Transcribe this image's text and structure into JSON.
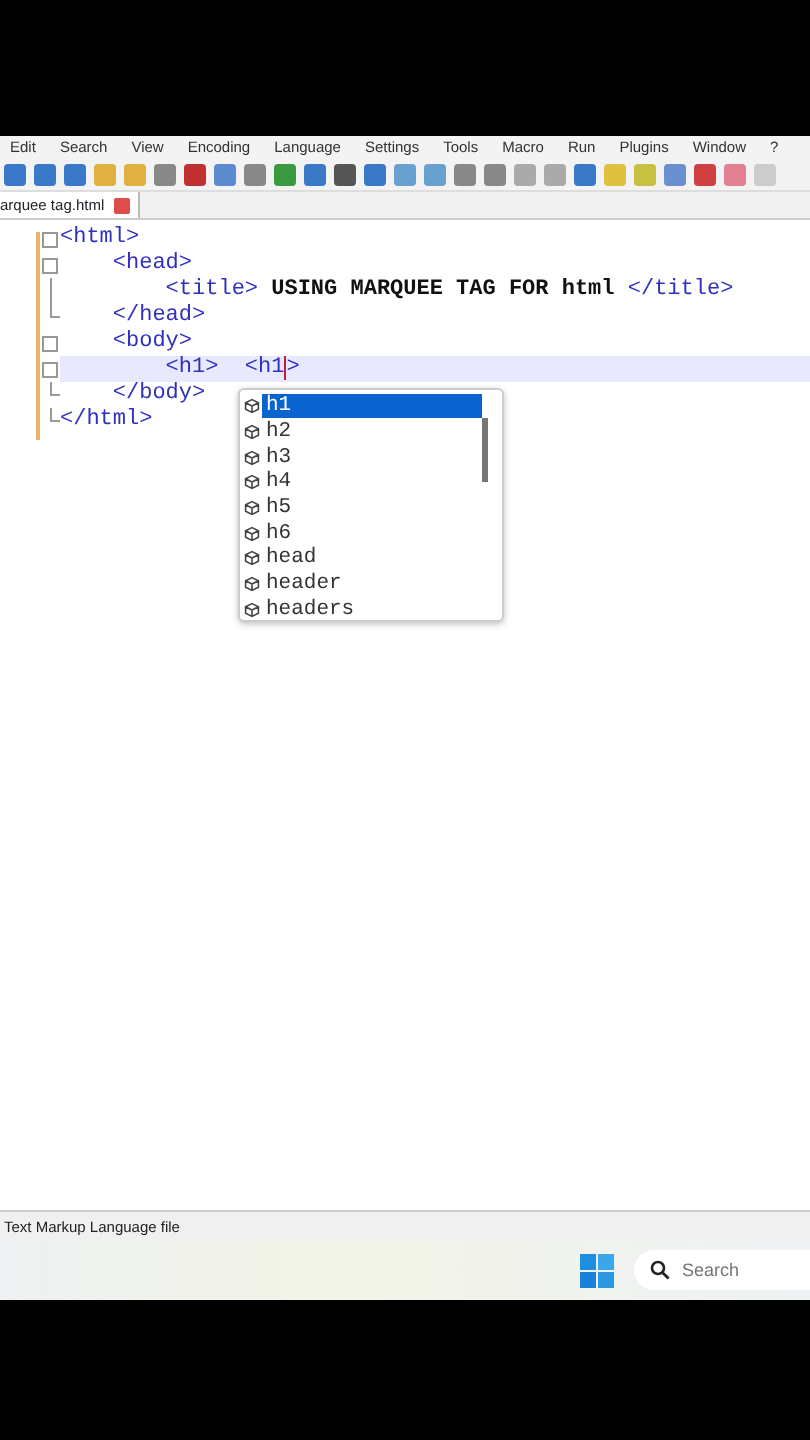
{
  "menu": [
    "Edit",
    "Search",
    "View",
    "Encoding",
    "Language",
    "Settings",
    "Tools",
    "Macro",
    "Run",
    "Plugins",
    "Window",
    "?"
  ],
  "tab": {
    "label": "arquee tag.html"
  },
  "code_lines": [
    {
      "kind": "start",
      "current": false,
      "parts": [
        {
          "kind": "tag",
          "text": "<html>"
        }
      ]
    },
    {
      "kind": "start",
      "current": false,
      "parts": [
        {
          "kind": "tag",
          "text": "    <head>"
        }
      ]
    },
    {
      "kind": "middle",
      "current": false,
      "parts": [
        {
          "kind": "tag",
          "text": "        <title>"
        },
        {
          "kind": "text",
          "text": " USING MARQUEE TAG FOR html "
        },
        {
          "kind": "tag",
          "text": "</title>"
        }
      ]
    },
    {
      "kind": "end",
      "current": false,
      "parts": [
        {
          "kind": "tag",
          "text": "    </head>"
        }
      ]
    },
    {
      "kind": "start",
      "current": false,
      "parts": [
        {
          "kind": "tag",
          "text": "    <body>"
        }
      ]
    },
    {
      "kind": "start",
      "current": true,
      "parts": [
        {
          "kind": "tag",
          "text": "        <h1>  <h1"
        },
        {
          "kind": "caret"
        },
        {
          "kind": "tag",
          "text": ">"
        }
      ]
    },
    {
      "kind": "end",
      "current": false,
      "parts": [
        {
          "kind": "tag",
          "text": "    </body>"
        }
      ]
    },
    {
      "kind": "end",
      "current": false,
      "parts": [
        {
          "kind": "tag",
          "text": "</html>"
        }
      ]
    }
  ],
  "autocomplete": [
    {
      "label": "h1",
      "selected": true
    },
    {
      "label": "h2",
      "selected": false
    },
    {
      "label": "h3",
      "selected": false
    },
    {
      "label": "h4",
      "selected": false
    },
    {
      "label": "h5",
      "selected": false
    },
    {
      "label": "h6",
      "selected": false
    },
    {
      "label": "head",
      "selected": false
    },
    {
      "label": "header",
      "selected": false
    },
    {
      "label": "headers",
      "selected": false
    }
  ],
  "status_bar": {
    "text": "Text Markup Language file"
  },
  "taskbar": {
    "search_placeholder": "Search"
  }
}
